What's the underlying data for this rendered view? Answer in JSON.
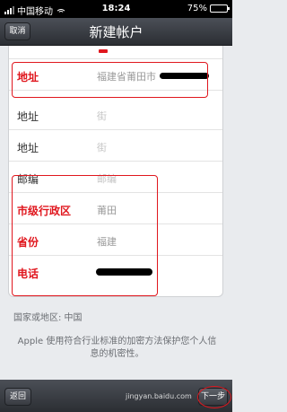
{
  "status_bar": {
    "carrier": "中国移动",
    "time": "18:24",
    "battery": "75%",
    "battery_level": 0.75
  },
  "nav": {
    "title": "新建帐户",
    "cancel_label": "取消"
  },
  "form": {
    "rows": [
      {
        "label": "地址",
        "value": "福建省莆田市"
      },
      {
        "label": "地址",
        "value": "街"
      },
      {
        "label": "地址",
        "value": "街"
      },
      {
        "label": "邮编",
        "value": "邮编"
      },
      {
        "label": "市级行政区",
        "value": "莆田"
      },
      {
        "label": "省份",
        "value": "福建"
      },
      {
        "label": "电话",
        "value": ""
      }
    ]
  },
  "region_line": "国家或地区: 中国",
  "privacy_note": "Apple 使用符合行业标准的加密方法保护您个人信息的机密性。",
  "toolbar": {
    "back_label": "返回",
    "next_label": "下一步",
    "watermark": "jingyan.baidu.com"
  }
}
